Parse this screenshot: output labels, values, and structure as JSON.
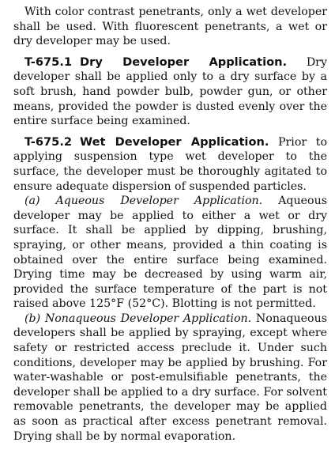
{
  "intro": "With color contrast penetrants, only a wet developer shall be used. With fluorescent penetrants, a wet or dry developer may be used.",
  "sections": [
    {
      "number": "T-675.1",
      "title": "Dry Developer Application.",
      "body": "Dry developer shall be applied only to a dry surface by a soft brush, hand powder bulb, powder gun, or other means, provided the powder is dusted evenly over the entire surface being examined."
    },
    {
      "number": "T-675.2",
      "title": "Wet Developer Application.",
      "body": "Prior to applying suspension type wet developer to the surface, the developer must be thoroughly agitated to ensure adequate dispersion of suspended particles.",
      "subsections": [
        {
          "label": "(a) Aqueous Developer Application.",
          "body": "Aqueous developer may be applied to either a wet or dry surface. It shall be applied by dipping, brushing, spraying, or other means, provided a thin coating is obtained over the entire surface being examined. Drying time may be decreased by using warm air, provided the surface temperature of the part is not raised above 125°F (52°C). Blotting is not permitted."
        },
        {
          "label": "(b) Nonaqueous Developer Application.",
          "body": "Nonaqueous developers shall be applied by spraying, except where safety or restricted access preclude it. Under such conditions, developer may be applied by brushing. For water-washable or post-emulsifiable penetrants, the developer shall be applied to a dry surface. For solvent removable penetrants, the developer may be applied as soon as practical after excess penetrant removal. Drying shall be by normal evaporation."
        }
      ]
    }
  ]
}
